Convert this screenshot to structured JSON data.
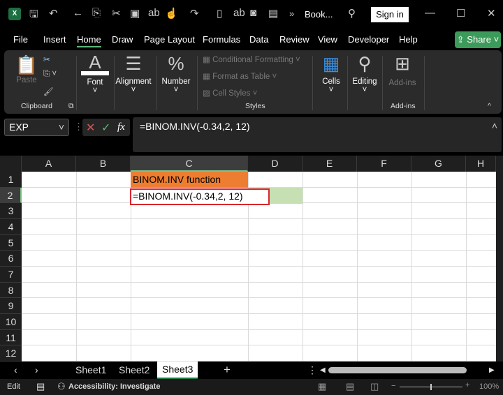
{
  "titlebar": {
    "filename": "Book...",
    "signin": "Sign in",
    "more": "»"
  },
  "tabs": [
    "File",
    "Insert",
    "Home",
    "Draw",
    "Page Layout",
    "Formulas",
    "Data",
    "Review",
    "View",
    "Developer",
    "Help"
  ],
  "active_tab": "Home",
  "share": "Share",
  "ribbon": {
    "paste": "Paste",
    "clipboard": "Clipboard",
    "font": "Font",
    "alignment": "Alignment",
    "number": "Number",
    "conditional_formatting": "Conditional Formatting",
    "format_as_table": "Format as Table",
    "cell_styles": "Cell Styles",
    "styles": "Styles",
    "cells": "Cells",
    "editing": "Editing",
    "addins_button": "Add-ins",
    "addins_group": "Add-ins"
  },
  "formula_bar": {
    "name_box": "EXP",
    "fx": "fx",
    "formula": "=BINOM.INV(-0.34,2, 12)"
  },
  "columns": [
    "A",
    "B",
    "C",
    "D",
    "E",
    "F",
    "G",
    "H"
  ],
  "rows": [
    "1",
    "2",
    "3",
    "4",
    "5",
    "6",
    "7",
    "8",
    "9",
    "10",
    "11",
    "12"
  ],
  "cells": {
    "C1": "BINOM.INV function",
    "C2": "=BINOM.INV(-0.34,2, 12)"
  },
  "colors": {
    "header_fill": "#ED7D31",
    "highlight_fill": "#C6E0B4",
    "edit_border": "#D9262B",
    "accent": "#3C9A5A"
  },
  "sheets": [
    "Sheet1",
    "Sheet2",
    "Sheet3"
  ],
  "active_sheet": "Sheet3",
  "status": {
    "mode": "Edit",
    "accessibility": "Accessibility: Investigate",
    "zoom": "100%"
  }
}
